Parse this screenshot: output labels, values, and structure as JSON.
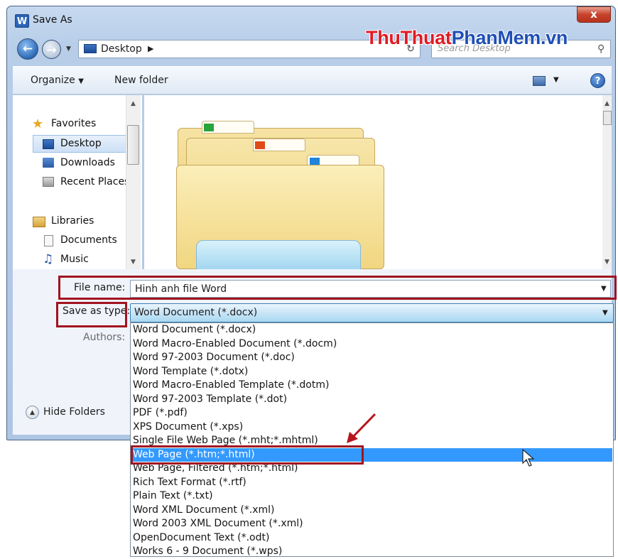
{
  "window": {
    "title": "Save As",
    "app_logo_letter": "W",
    "close_label": "x"
  },
  "address": {
    "location": "Desktop",
    "search_placeholder": "Search Desktop"
  },
  "watermark": {
    "part1": "Thu",
    "part2": "Thuat",
    "part3": "Phan",
    "part4": "Mem",
    "part5": ".vn"
  },
  "toolbar": {
    "organize_label": "Organize",
    "new_folder_label": "New folder",
    "help_label": "?"
  },
  "nav": {
    "favorites": "Favorites",
    "desktop": "Desktop",
    "downloads": "Downloads",
    "recent_places": "Recent Places",
    "libraries": "Libraries",
    "documents": "Documents",
    "music": "Music"
  },
  "form": {
    "filename_label": "File name:",
    "filename_value": "Hinh anh file Word",
    "savetype_label": "Save as type:",
    "savetype_value": "Word Document (*.docx)",
    "authors_label": "Authors:",
    "hide_folders": "Hide Folders"
  },
  "type_options": [
    "Word Document (*.docx)",
    "Word Macro-Enabled Document (*.docm)",
    "Word 97-2003 Document (*.doc)",
    "Word Template (*.dotx)",
    "Word Macro-Enabled Template (*.dotm)",
    "Word 97-2003 Template (*.dot)",
    "PDF (*.pdf)",
    "XPS Document (*.xps)",
    "Single File Web Page (*.mht;*.mhtml)",
    "Web Page (*.htm;*.html)",
    "Web Page, Filtered (*.htm;*.html)",
    "Rich Text Format (*.rtf)",
    "Plain Text (*.txt)",
    "Word XML Document (*.xml)",
    "Word 2003 XML Document (*.xml)",
    "OpenDocument Text (*.odt)",
    "Works 6 - 9 Document (*.wps)"
  ],
  "selected_option": "Web Page (*.htm;*.html)",
  "colors": {
    "highlight": "#3399ff",
    "annotation_red": "#a01420",
    "watermark_red": "#e01b24",
    "watermark_blue": "#1f4fb5"
  }
}
